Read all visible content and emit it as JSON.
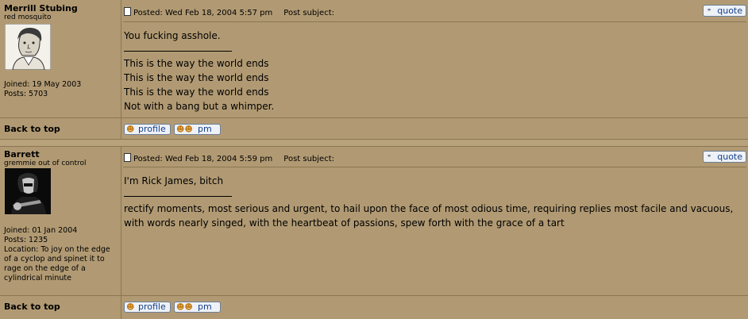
{
  "posts": [
    {
      "author": "Merrill Stubing",
      "rank": "red mosquito",
      "joined": "Joined: 19 May 2003",
      "posts": "Posts: 5703",
      "location": "",
      "posted": "Posted: Wed Feb 18, 2004 5:57 pm",
      "subject": "Post subject:",
      "quote": "quote",
      "message": "You fucking asshole.",
      "signature": [
        "This is the way the world ends",
        "This is the way the world ends",
        "This is the way the world ends",
        "Not with a bang but a whimper."
      ],
      "back_to_top": "Back to top",
      "profile": "profile",
      "pm": "pm"
    },
    {
      "author": "Barrett",
      "rank": "gremmie out of control",
      "joined": "Joined: 01 Jan 2004",
      "posts": "Posts: 1235",
      "location": "Location: To joy on the edge of a cyclop and spinet it to rage on the edge of a cylindrical minute",
      "posted": "Posted: Wed Feb 18, 2004 5:59 pm",
      "subject": "Post subject:",
      "quote": "quote",
      "message": "I'm Rick James, bitch",
      "signature": [
        "rectify moments, most serious and urgent, to hail upon the face of most odious time, requiring replies most facile and vacuous, with words nearly singed, with the heartbeat of passions, spew forth with the grace of a tart"
      ],
      "back_to_top": "Back to top",
      "profile": "profile",
      "pm": "pm"
    }
  ]
}
